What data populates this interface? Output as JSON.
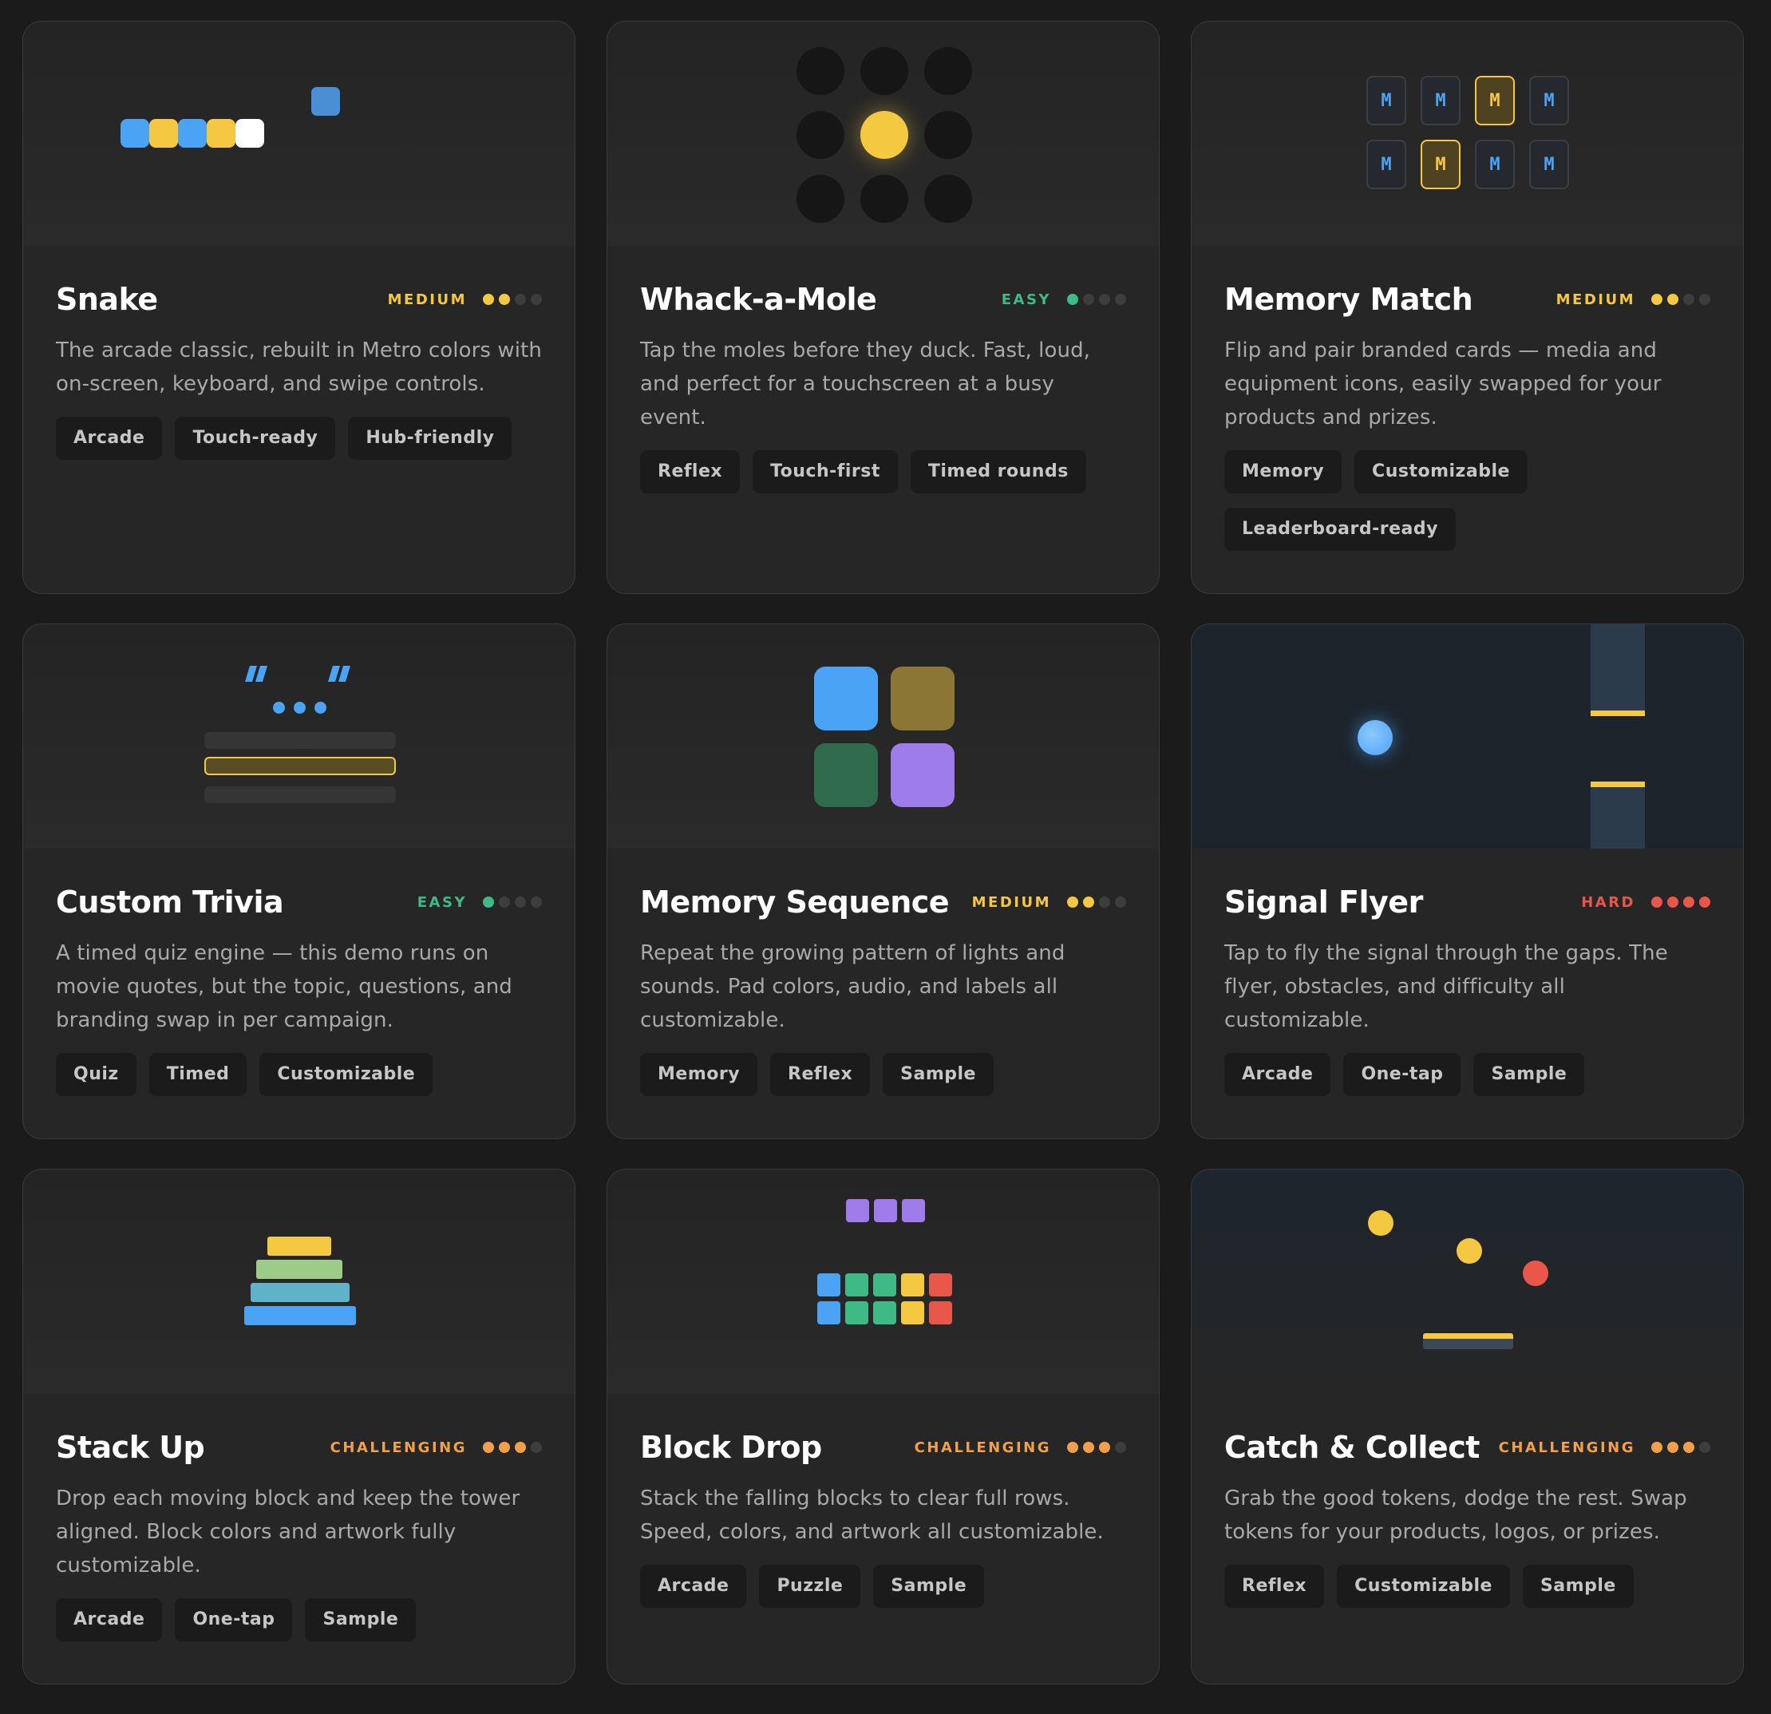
{
  "colors": {
    "yellow": "#f5c842",
    "blue": "#4aa3f5",
    "green": "#3dba85",
    "red": "#e8574a",
    "orange": "#f0a04b",
    "purple": "#9e7cea"
  },
  "cards": [
    {
      "title": "Snake",
      "difficulty": "MEDIUM",
      "level": 2,
      "color": "#f5c842",
      "description": "The arcade classic, rebuilt in Metro colors with on-screen, keyboard, and swipe controls.",
      "tags": [
        "Arcade",
        "Touch-ready",
        "Hub-friendly"
      ]
    },
    {
      "title": "Whack-a-Mole",
      "difficulty": "EASY",
      "level": 1,
      "color": "#3dba85",
      "description": "Tap the moles before they duck. Fast, loud, and perfect for a touchscreen at a busy event.",
      "tags": [
        "Reflex",
        "Touch-first",
        "Timed rounds"
      ]
    },
    {
      "title": "Memory Match",
      "difficulty": "MEDIUM",
      "level": 2,
      "color": "#f5c842",
      "description": "Flip and pair branded cards — media and equipment icons, easily swapped for your products and prizes.",
      "tags": [
        "Memory",
        "Customizable",
        "Leaderboard-ready"
      ],
      "tile_letter": "M"
    },
    {
      "title": "Custom Trivia",
      "difficulty": "EASY",
      "level": 1,
      "color": "#3dba85",
      "description": "A timed quiz engine — this demo runs on movie quotes, but the topic, questions, and branding swap in per campaign.",
      "tags": [
        "Quiz",
        "Timed",
        "Customizable"
      ]
    },
    {
      "title": "Memory Sequence",
      "difficulty": "MEDIUM",
      "level": 2,
      "color": "#f5c842",
      "description": "Repeat the growing pattern of lights and sounds. Pad colors, audio, and labels all customizable.",
      "tags": [
        "Memory",
        "Reflex",
        "Sample"
      ]
    },
    {
      "title": "Signal Flyer",
      "difficulty": "HARD",
      "level": 4,
      "color": "#e8574a",
      "description": "Tap to fly the signal through the gaps. The flyer, obstacles, and difficulty all customizable.",
      "tags": [
        "Arcade",
        "One-tap",
        "Sample"
      ]
    },
    {
      "title": "Stack Up",
      "difficulty": "CHALLENGING",
      "level": 3,
      "color": "#f0a04b",
      "description": "Drop each moving block and keep the tower aligned. Block colors and artwork fully customizable.",
      "tags": [
        "Arcade",
        "One-tap",
        "Sample"
      ]
    },
    {
      "title": "Block Drop",
      "difficulty": "CHALLENGING",
      "level": 3,
      "color": "#f0a04b",
      "description": "Stack the falling blocks to clear full rows. Speed, colors, and artwork all customizable.",
      "tags": [
        "Arcade",
        "Puzzle",
        "Sample"
      ]
    },
    {
      "title": "Catch & Collect",
      "difficulty": "CHALLENGING",
      "level": 3,
      "color": "#f0a04b",
      "description": "Grab the good tokens, dodge the rest. Swap tokens for your products, logos, or prizes.",
      "tags": [
        "Reflex",
        "Customizable",
        "Sample"
      ]
    }
  ]
}
